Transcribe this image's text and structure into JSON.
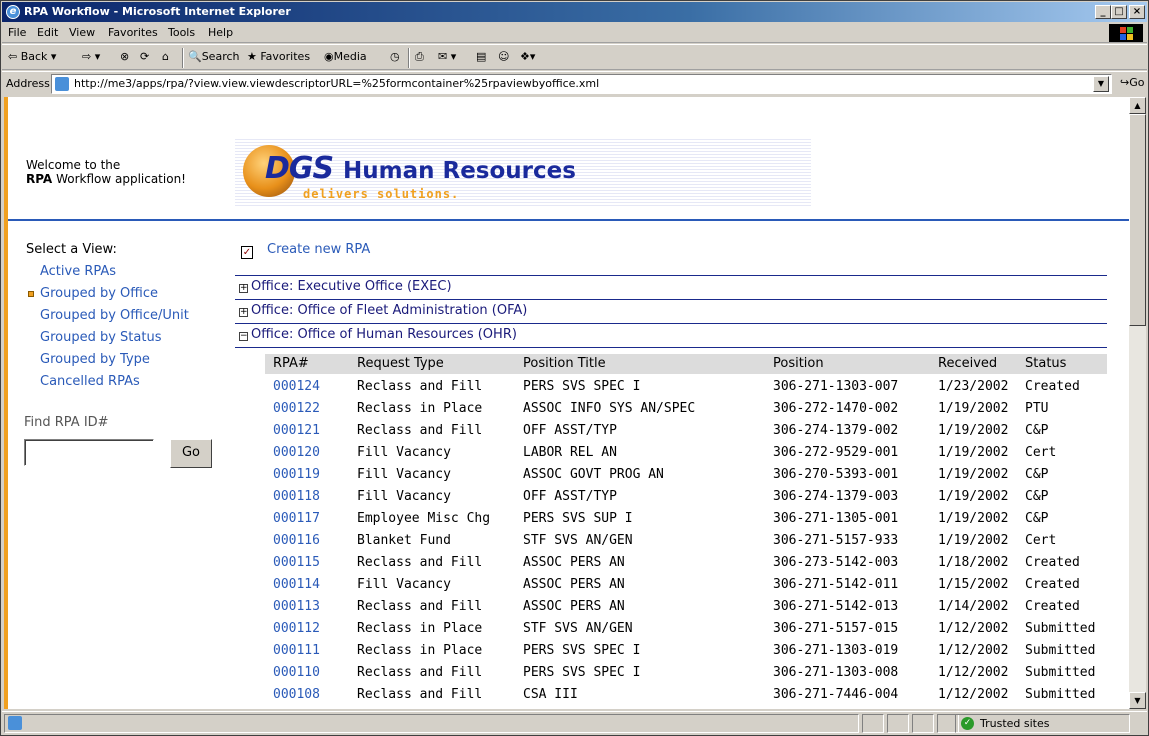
{
  "window": {
    "title": "RPA Workflow - Microsoft Internet Explorer"
  },
  "menu": [
    "File",
    "Edit",
    "View",
    "Favorites",
    "Tools",
    "Help"
  ],
  "toolbar": {
    "back": "Back",
    "search": "Search",
    "favorites": "Favorites",
    "media": "Media"
  },
  "address": {
    "label": "Address",
    "url": "http://me3/apps/rpa/?view.view.viewdescriptorURL=%25formcontainer%25rpaviewbyoffice.xml",
    "go": "Go"
  },
  "header": {
    "welcome_prefix": "Welcome to the",
    "welcome_app": "RPA",
    "welcome_suffix": "Workflow application!"
  },
  "banner": {
    "brand": "DGS",
    "title": "Human Resources",
    "tagline": "delivers solutions."
  },
  "nav": {
    "heading": "Select a View:",
    "items": [
      "Active RPAs",
      "Grouped by Office",
      "Grouped by Office/Unit",
      "Grouped by Status",
      "Grouped by Type",
      "Cancelled RPAs"
    ],
    "selected": "Grouped by Office"
  },
  "find": {
    "label": "Find RPA ID#",
    "value": "",
    "button": "Go"
  },
  "create_label": "Create new RPA",
  "offices": [
    {
      "label": "Office: Executive Office (EXEC)",
      "expanded": false
    },
    {
      "label": "Office: Office of Fleet Administration (OFA)",
      "expanded": false
    },
    {
      "label": "Office: Office of Human Resources (OHR)",
      "expanded": true
    }
  ],
  "table": {
    "columns": [
      "RPA#",
      "Request Type",
      "Position Title",
      "Position",
      "Received",
      "Status"
    ],
    "rows": [
      [
        "000124",
        "Reclass and Fill",
        "PERS SVS SPEC I",
        "306-271-1303-007",
        "1/23/2002",
        "Created"
      ],
      [
        "000122",
        "Reclass in Place",
        "ASSOC INFO SYS AN/SPEC",
        "306-272-1470-002",
        "1/19/2002",
        "PTU"
      ],
      [
        "000121",
        "Reclass and Fill",
        "OFF ASST/TYP",
        "306-274-1379-002",
        "1/19/2002",
        "C&P"
      ],
      [
        "000120",
        "Fill Vacancy",
        "LABOR REL AN",
        "306-272-9529-001",
        "1/19/2002",
        "Cert"
      ],
      [
        "000119",
        "Fill Vacancy",
        "ASSOC GOVT PROG AN",
        "306-270-5393-001",
        "1/19/2002",
        "C&P"
      ],
      [
        "000118",
        "Fill Vacancy",
        "OFF ASST/TYP",
        "306-274-1379-003",
        "1/19/2002",
        "C&P"
      ],
      [
        "000117",
        "Employee Misc Chg",
        "PERS SVS SUP I",
        "306-271-1305-001",
        "1/19/2002",
        "C&P"
      ],
      [
        "000116",
        "Blanket Fund",
        "STF SVS AN/GEN",
        "306-271-5157-933",
        "1/19/2002",
        "Cert"
      ],
      [
        "000115",
        "Reclass and Fill",
        "ASSOC PERS AN",
        "306-273-5142-003",
        "1/18/2002",
        "Created"
      ],
      [
        "000114",
        "Fill Vacancy",
        "ASSOC PERS AN",
        "306-271-5142-011",
        "1/15/2002",
        "Created"
      ],
      [
        "000113",
        "Reclass and Fill",
        "ASSOC PERS AN",
        "306-271-5142-013",
        "1/14/2002",
        "Created"
      ],
      [
        "000112",
        "Reclass in Place",
        "STF SVS AN/GEN",
        "306-271-5157-015",
        "1/12/2002",
        "Submitted"
      ],
      [
        "000111",
        "Reclass in Place",
        "PERS SVS SPEC I",
        "306-271-1303-019",
        "1/12/2002",
        "Submitted"
      ],
      [
        "000110",
        "Reclass and Fill",
        "PERS SVS SPEC I",
        "306-271-1303-008",
        "1/12/2002",
        "Submitted"
      ],
      [
        "000108",
        "Reclass and Fill",
        "CSA III",
        "306-271-7446-004",
        "1/12/2002",
        "Submitted"
      ]
    ]
  },
  "status": {
    "zone": "Trusted sites"
  }
}
